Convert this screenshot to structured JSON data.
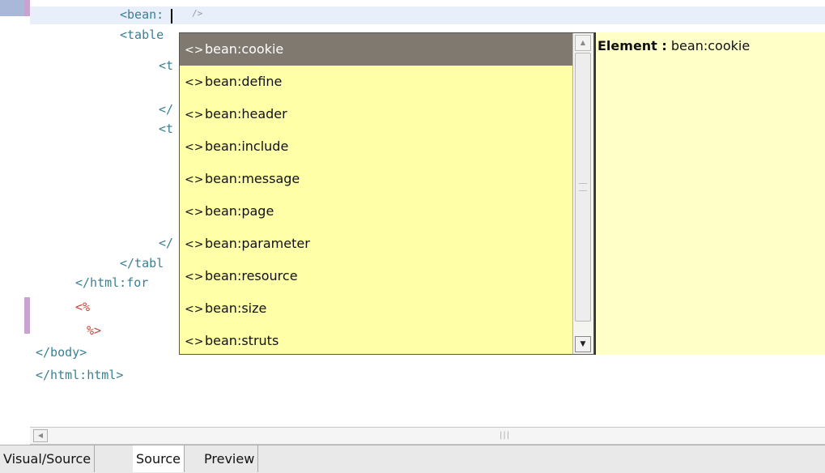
{
  "editor": {
    "code_lines": [
      {
        "text": "<bean:",
        "style": "normal"
      },
      {
        "text": "<table",
        "style": "normal"
      },
      {
        "text": "<t",
        "style": "normal"
      },
      {
        "text": "</",
        "style": "normal"
      },
      {
        "text": "<t",
        "style": "normal"
      },
      {
        "text": "</",
        "style": "normal"
      },
      {
        "text": "</tabl",
        "style": "normal"
      },
      {
        "text": "</html:for",
        "style": "normal"
      },
      {
        "text": "<%",
        "style": "jsp"
      },
      {
        "text": "%>",
        "style": "jsp"
      },
      {
        "text": "</body>",
        "style": "normal"
      },
      {
        "text": "</html:html>",
        "style": "normal"
      }
    ],
    "cursor_hint": "/>"
  },
  "completion": {
    "items": [
      {
        "icon": "tag-icon",
        "glyph": "<>",
        "label": "bean:cookie",
        "selected": true
      },
      {
        "icon": "tag-icon",
        "glyph": "<>",
        "label": "bean:define",
        "selected": false
      },
      {
        "icon": "tag-icon",
        "glyph": "<>",
        "label": "bean:header",
        "selected": false
      },
      {
        "icon": "tag-icon",
        "glyph": "<>",
        "label": "bean:include",
        "selected": false
      },
      {
        "icon": "tag-icon",
        "glyph": "<>",
        "label": "bean:message",
        "selected": false
      },
      {
        "icon": "tag-icon",
        "glyph": "<>",
        "label": "bean:page",
        "selected": false
      },
      {
        "icon": "tag-icon",
        "glyph": "<>",
        "label": "bean:parameter",
        "selected": false
      },
      {
        "icon": "tag-icon",
        "glyph": "<>",
        "label": "bean:resource",
        "selected": false
      },
      {
        "icon": "tag-icon",
        "glyph": "<>",
        "label": "bean:size",
        "selected": false
      },
      {
        "icon": "tag-icon",
        "glyph": "<>",
        "label": "bean:struts",
        "selected": false
      }
    ],
    "doc": {
      "label": "Element :",
      "value": "bean:cookie"
    }
  },
  "hscroll": {
    "grip": "|||"
  },
  "tabs": [
    {
      "label": "Visual/Source",
      "active": false
    },
    {
      "label": "Source",
      "active": true
    },
    {
      "label": "Preview",
      "active": false
    }
  ],
  "colors": {
    "popup_bg": "#ffffa8",
    "doc_bg": "#ffffc8",
    "selection": "#7f7970",
    "code_tag": "#3a8090",
    "code_jsp": "#c4463a"
  }
}
